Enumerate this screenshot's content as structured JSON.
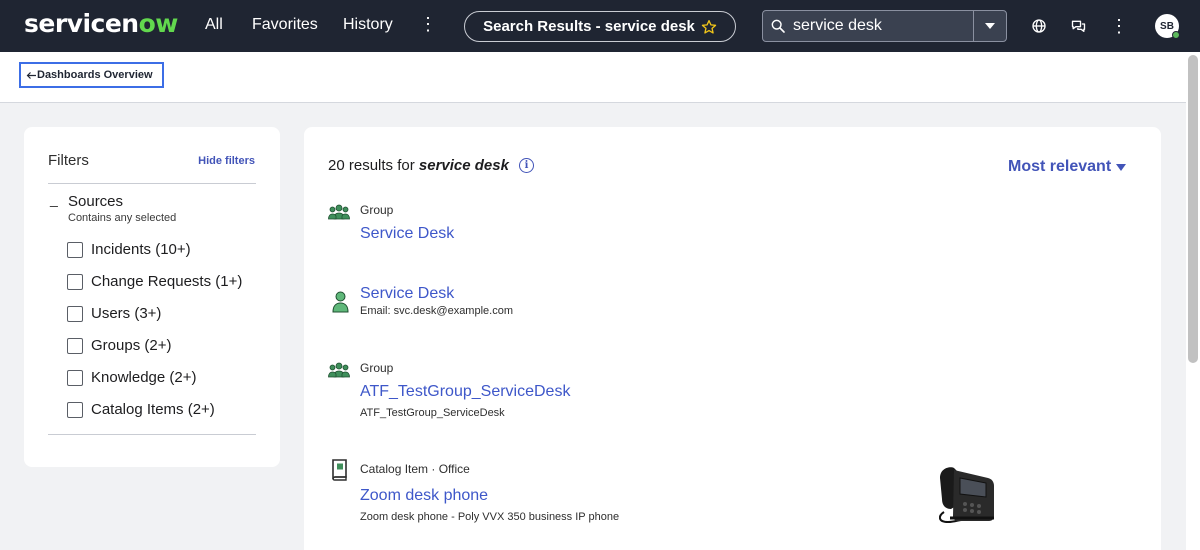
{
  "nav": {
    "logo_pre": "servicen",
    "logo_ow": "ow",
    "all": "All",
    "favorites": "Favorites",
    "history": "History",
    "more": "⋮",
    "title": "Search Results - service desk",
    "search_value": "service desk",
    "avatar": "SB"
  },
  "breadcrumb": {
    "back_label": "Dashboards Overview"
  },
  "filters": {
    "title": "Filters",
    "hide_label": "Hide filters",
    "collapse_symbol": "_",
    "sources_label": "Sources",
    "sources_sub": "Contains any selected",
    "options": [
      "Incidents (10+)",
      "Change Requests (1+)",
      "Users (3+)",
      "Groups (2+)",
      "Knowledge (2+)",
      "Catalog Items (2+)"
    ]
  },
  "results": {
    "count_text": "20 results for",
    "query": "service desk",
    "sort_label": "Most relevant",
    "items": [
      {
        "category": "Group",
        "title": "Service Desk",
        "subtitle": "",
        "icon": "group-icon"
      },
      {
        "category": "",
        "title": "Service Desk",
        "subtitle": "Email: svc.desk@example.com",
        "icon": "user-icon"
      },
      {
        "category": "Group",
        "title": "ATF_TestGroup_ServiceDesk",
        "subtitle": "ATF_TestGroup_ServiceDesk",
        "icon": "group-icon"
      },
      {
        "category": "Catalog Item · Office",
        "title": "Zoom desk phone",
        "subtitle": "Zoom desk phone - Poly VVX 350 business IP phone",
        "icon": "catalog-icon"
      }
    ]
  },
  "colors": {
    "nav_bg": "#1f2532",
    "accent": "#4254b8",
    "link": "#3e57c9",
    "brand_green": "#62d84e"
  }
}
